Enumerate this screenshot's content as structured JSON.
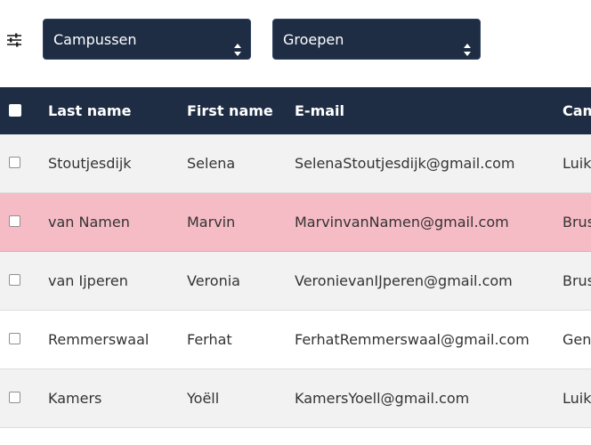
{
  "filters": {
    "filter_icon": "sliders-icon",
    "campus_select": "Campussen",
    "groups_select": "Groepen"
  },
  "table": {
    "headers": {
      "last_name": "Last name",
      "first_name": "First name",
      "email": "E-mail",
      "campus": "Cam"
    },
    "rows": [
      {
        "last_name": "Stoutjesdijk",
        "first_name": "Selena",
        "email": "SelenaStoutjesdijk@gmail.com",
        "campus": "Luik"
      },
      {
        "last_name": "van Namen",
        "first_name": "Marvin",
        "email": "MarvinvanNamen@gmail.com",
        "campus": "Brus"
      },
      {
        "last_name": "van Ijperen",
        "first_name": "Veronia",
        "email": "VeronievanIJperen@gmail.com",
        "campus": "Brus"
      },
      {
        "last_name": "Remmerswaal",
        "first_name": "Ferhat",
        "email": "FerhatRemmerswaal@gmail.com",
        "campus": "Gen"
      },
      {
        "last_name": "Kamers",
        "first_name": "Yoëll",
        "email": "KamersYoell@gmail.com",
        "campus": "Luik"
      }
    ]
  },
  "colors": {
    "header_bg": "#1e2d44",
    "selected_row": "#f6bcc5",
    "striped_row": "#f2f2f2"
  }
}
